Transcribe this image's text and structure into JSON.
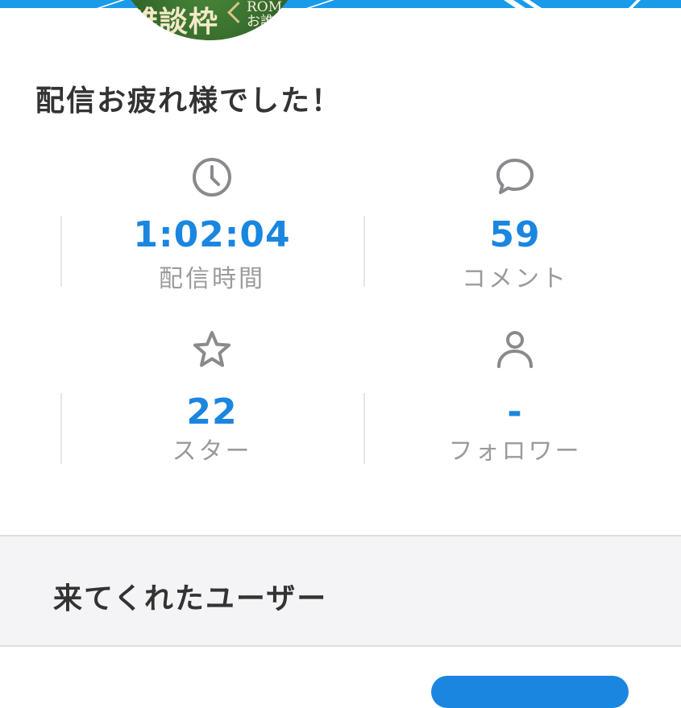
{
  "banner": {
    "color": "#1a9bea"
  },
  "thumbnail": {
    "title_text": "雑談枠",
    "sub_text_1": "ROM",
    "sub_text_2": "お誰"
  },
  "headline": "配信お疲れ様でした！",
  "stats": [
    {
      "icon": "clock-icon",
      "value": "1:02:04",
      "label": "配信時間"
    },
    {
      "icon": "comment-icon",
      "value": "59",
      "label": "コメント"
    },
    {
      "icon": "star-icon",
      "value": "22",
      "label": "スター"
    },
    {
      "icon": "user-icon",
      "value": "-",
      "label": "フォロワー"
    }
  ],
  "colors": {
    "accent": "#1a86e0",
    "text": "#333333",
    "label": "#9b9b9b",
    "icon": "#8a8a8e"
  },
  "section": {
    "title": "来てくれたユーザー"
  }
}
